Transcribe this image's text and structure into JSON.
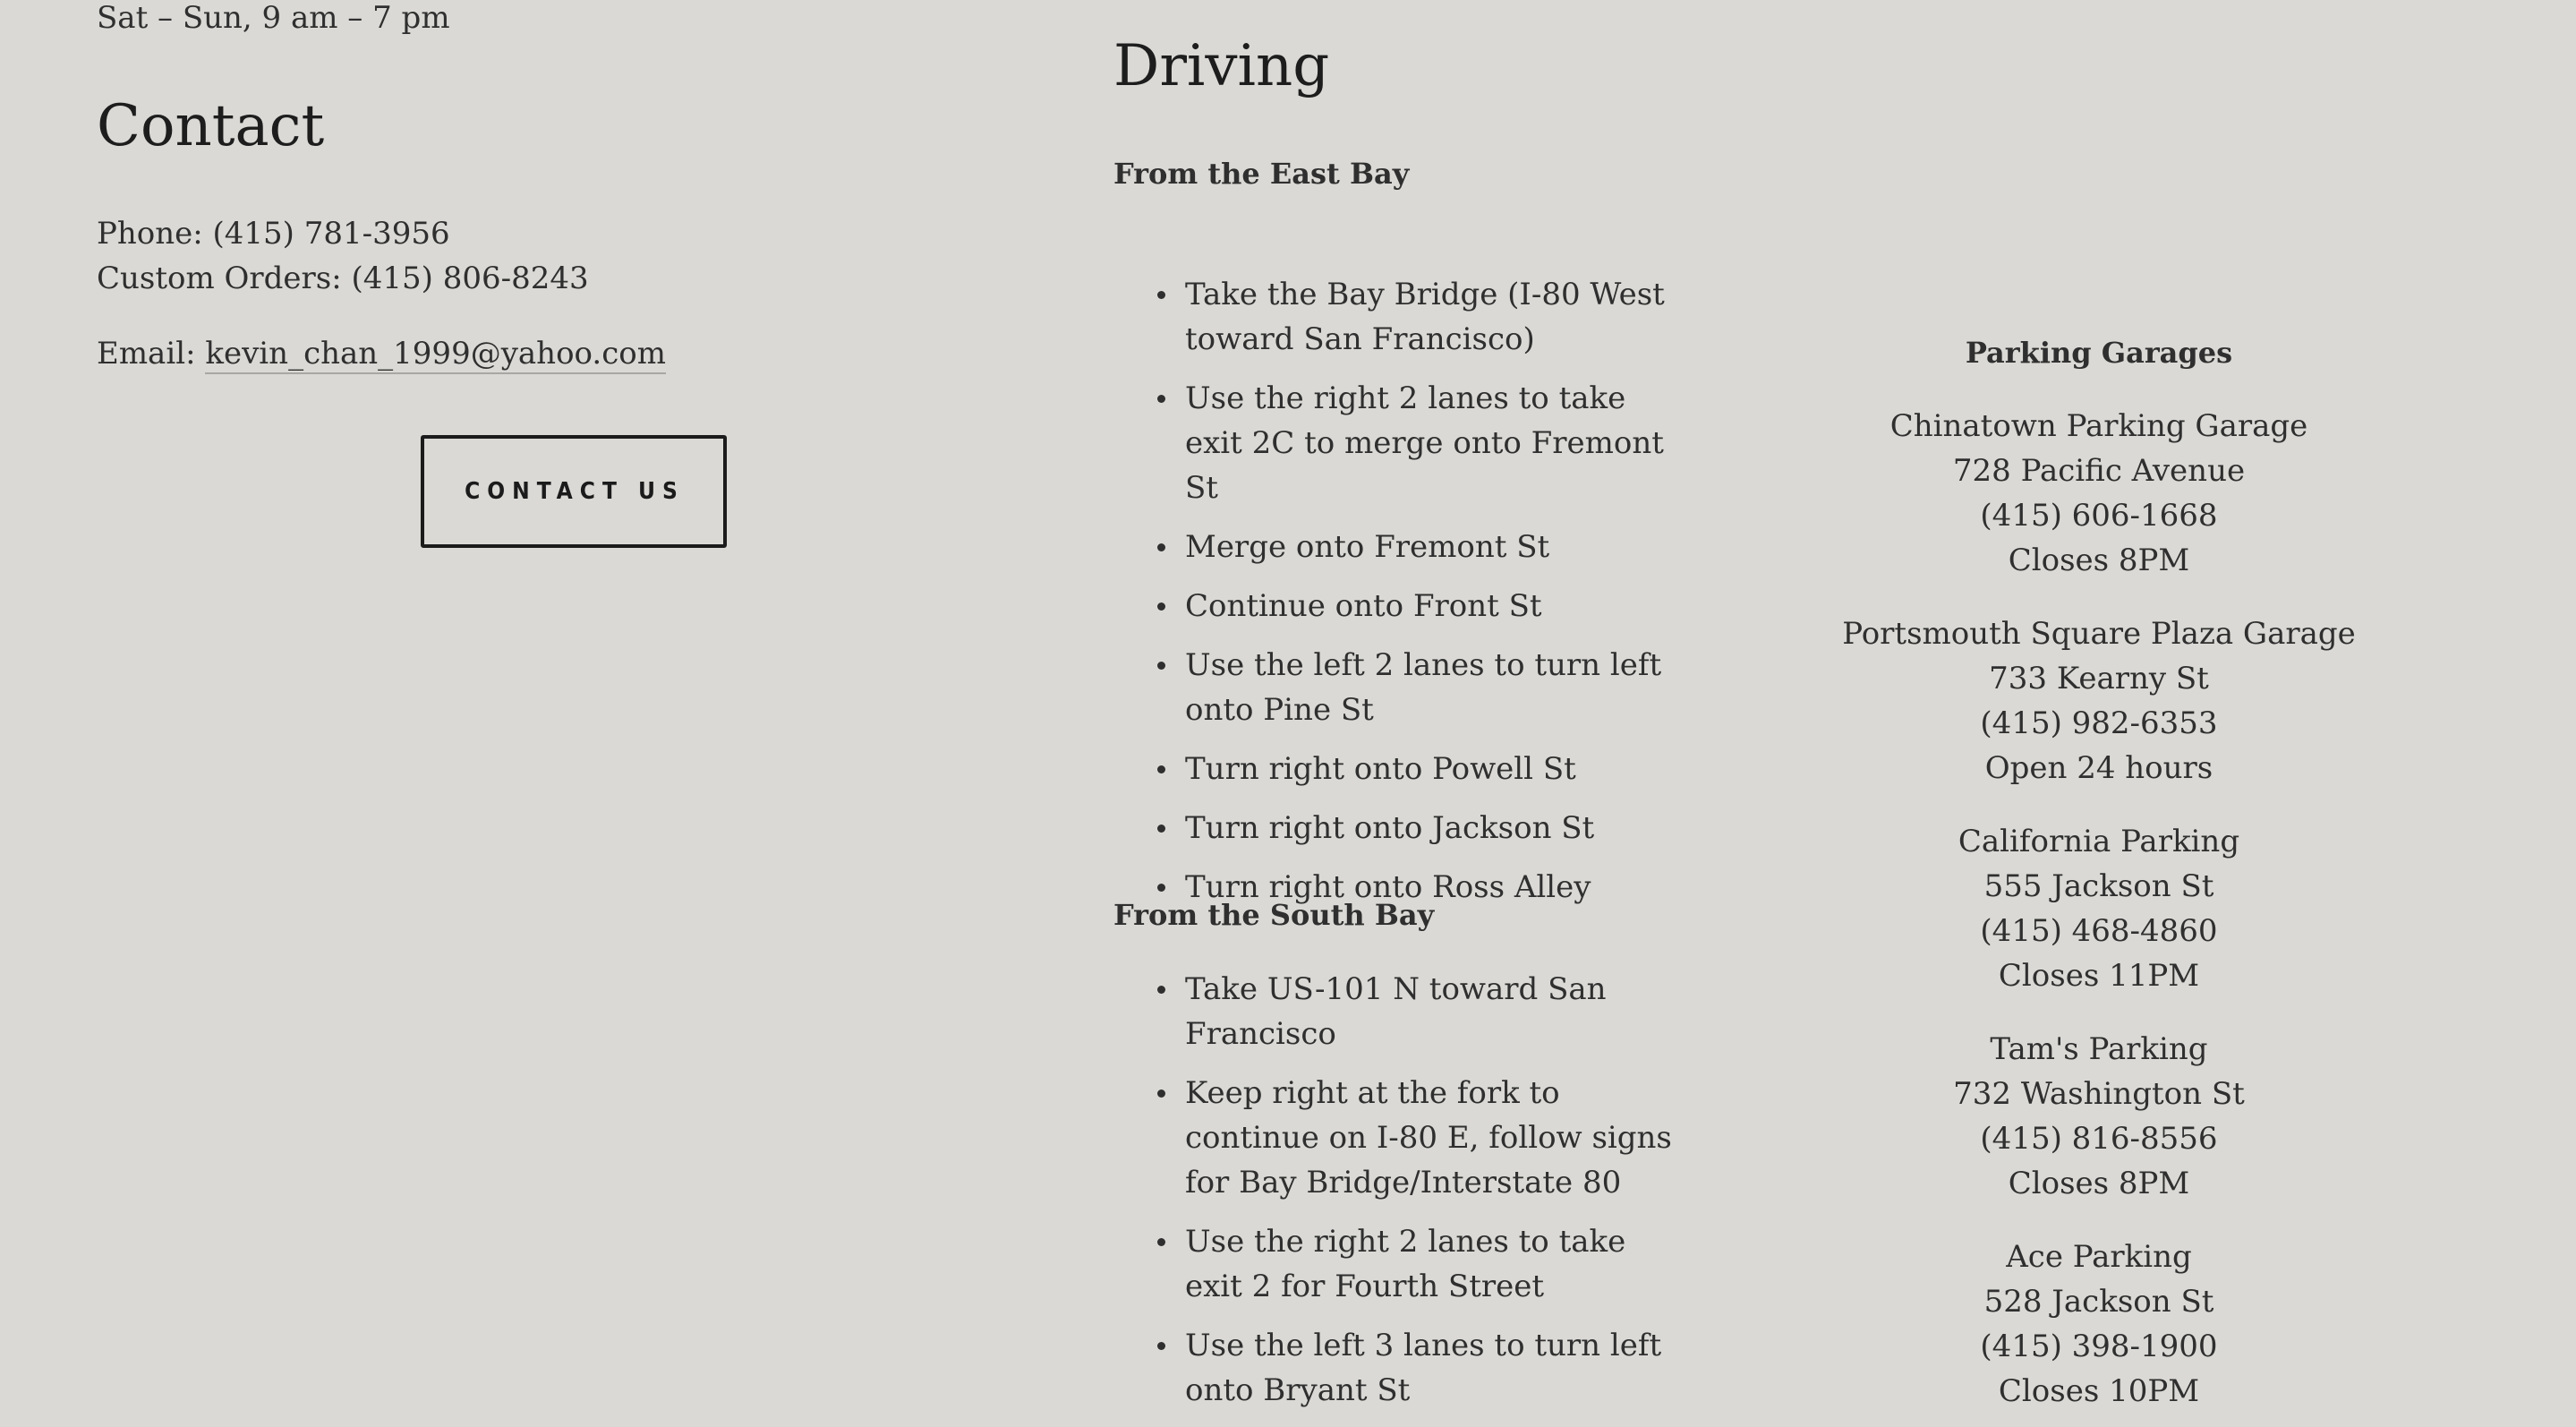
{
  "contact": {
    "hours": "Sat – Sun, 9 am – 7 pm",
    "title": "Contact",
    "phone": "Phone: (415) 781-3956",
    "custom_orders": "Custom Orders: (415) 806-8243",
    "email_label": "Email:",
    "email": "kevin_chan_1999@yahoo.com",
    "button_label": "CONTACT US"
  },
  "driving": {
    "title": "Driving",
    "east_bay": {
      "heading": "From the East Bay",
      "steps": [
        "Take the Bay Bridge (I-80 West toward San Francisco)",
        "Use the right 2 lanes to take exit 2C to merge onto Fremont St",
        "Merge onto Fremont St",
        "Continue onto Front St",
        "Use the left 2 lanes to turn left onto Pine St",
        "Turn right onto Powell St",
        "Turn right onto Jackson St",
        "Turn right onto Ross Alley"
      ]
    },
    "south_bay": {
      "heading": "From the South Bay",
      "steps": [
        "Take US-101 N toward San Francisco",
        "Keep right at the fork to continue on I-80 E, follow signs for Bay Bridge/Interstate 80",
        "Use the right 2 lanes to take exit 2 for Fourth Street",
        "Use the left 3 lanes to turn left onto Bryant St"
      ]
    }
  },
  "parking": {
    "title": "Parking Garages",
    "garages": [
      {
        "name": "Chinatown Parking Garage",
        "address": "728 Pacific Avenue",
        "phone": "(415) 606-1668",
        "hours": "Closes 8PM"
      },
      {
        "name": "Portsmouth Square Plaza Garage",
        "address": "733 Kearny St",
        "phone": "(415) 982-6353",
        "hours": "Open 24 hours"
      },
      {
        "name": "California Parking",
        "address": "555 Jackson St",
        "phone": "(415) 468-4860",
        "hours": "Closes 11PM"
      },
      {
        "name": "Tam's Parking",
        "address": "732 Washington St",
        "phone": "(415) 816-8556",
        "hours": "Closes 8PM"
      },
      {
        "name": "Ace Parking",
        "address": "528 Jackson St",
        "phone": "(415) 398-1900",
        "hours": "Closes 10PM"
      }
    ]
  }
}
